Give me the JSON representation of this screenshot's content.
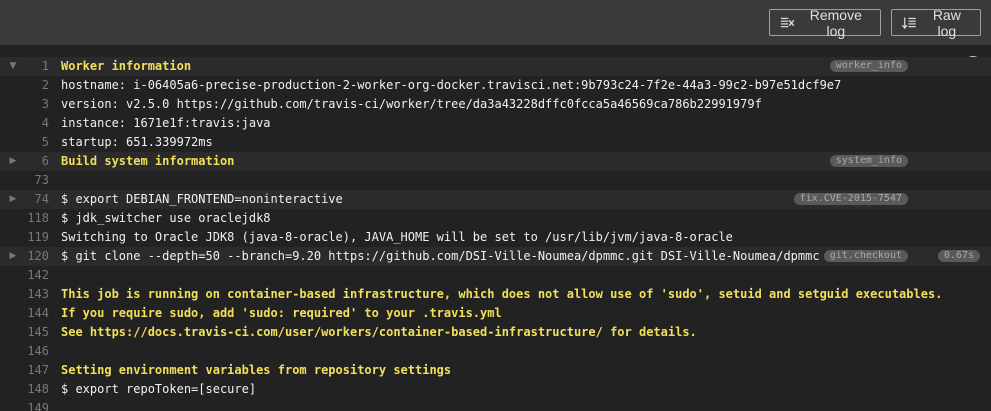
{
  "toolbar": {
    "remove_log_label": "Remove log",
    "raw_log_label": "Raw log"
  },
  "log": {
    "lines": [
      {
        "num": "1",
        "text": "Worker information",
        "style": "yellow",
        "fold": "open",
        "tag": "worker_info"
      },
      {
        "num": "2",
        "text": "hostname: i-06405a6-precise-production-2-worker-org-docker.travisci.net:9b793c24-7f2e-44a3-99c2-b97e51dcf9e7",
        "style": "normal"
      },
      {
        "num": "3",
        "text": "version: v2.5.0 https://github.com/travis-ci/worker/tree/da3a43228dffc0fcca5a46569ca786b22991979f",
        "style": "normal"
      },
      {
        "num": "4",
        "text": "instance: 1671e1f:travis:java",
        "style": "normal"
      },
      {
        "num": "5",
        "text": "startup: 651.339972ms",
        "style": "normal"
      },
      {
        "num": "6",
        "text": "Build system information",
        "style": "yellow",
        "fold": "closed",
        "tag": "system_info"
      },
      {
        "num": "73",
        "text": "",
        "style": "normal"
      },
      {
        "num": "74",
        "text": "$ export DEBIAN_FRONTEND=noninteractive",
        "style": "normal",
        "fold": "closed",
        "tag": "fix.CVE-2015-7547"
      },
      {
        "num": "118",
        "text": "$ jdk_switcher use oraclejdk8",
        "style": "normal"
      },
      {
        "num": "119",
        "text": "Switching to Oracle JDK8 (java-8-oracle), JAVA_HOME will be set to /usr/lib/jvm/java-8-oracle",
        "style": "normal"
      },
      {
        "num": "120",
        "text": "$ git clone --depth=50 --branch=9.20 https://github.com/DSI-Ville-Noumea/dpmmc.git DSI-Ville-Noumea/dpmmc",
        "style": "normal",
        "fold": "closed",
        "tag": "git.checkout",
        "duration": "0.67s"
      },
      {
        "num": "142",
        "text": "",
        "style": "normal"
      },
      {
        "num": "143",
        "text": "This job is running on container-based infrastructure, which does not allow use of 'sudo', setuid and setguid executables.",
        "style": "yellow"
      },
      {
        "num": "144",
        "text": "If you require sudo, add 'sudo: required' to your .travis.yml",
        "style": "yellow"
      },
      {
        "num": "145",
        "text": "See https://docs.travis-ci.com/user/workers/container-based-infrastructure/ for details.",
        "style": "yellow"
      },
      {
        "num": "146",
        "text": "",
        "style": "normal"
      },
      {
        "num": "147",
        "text": "Setting environment variables from repository settings",
        "style": "yellow"
      },
      {
        "num": "148",
        "text": "$ export repoToken=[secure]",
        "style": "normal"
      },
      {
        "num": "149",
        "text": "",
        "style": "normal"
      }
    ]
  },
  "colors": {
    "background": "#222222",
    "toolbar": "#3a3a3a",
    "highlight_text": "#f1e05a",
    "line_number": "#777777"
  },
  "icons": {
    "remove": "remove-log-icon",
    "raw": "raw-log-icon",
    "fold_open": "triangle-down-icon",
    "fold_closed": "triangle-right-icon",
    "status": "status-circle-icon"
  }
}
